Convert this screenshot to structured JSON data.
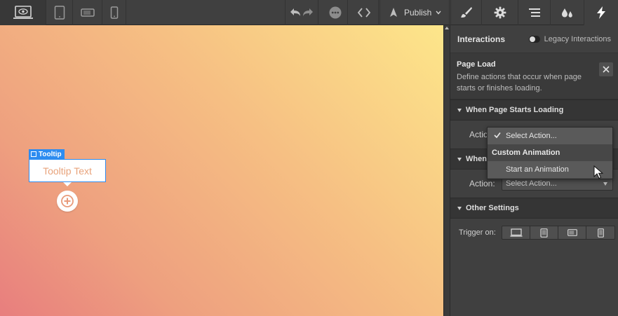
{
  "toolbar": {
    "publish_label": "Publish",
    "devices": [
      "desktop",
      "tablet",
      "mobile-landscape",
      "mobile-portrait"
    ]
  },
  "canvas": {
    "element_label": "Tooltip",
    "tooltip_text": "Tooltip Text"
  },
  "panel": {
    "header_title": "Interactions",
    "legacy_label": "Legacy Interactions",
    "page_load_title": "Page Load",
    "page_load_desc": "Define actions that occur when page starts or finishes loading.",
    "section_starts": "When Page Starts Loading",
    "section_finishes": "When",
    "action_label": "Action:",
    "action_label_top": "Actio",
    "select_placeholder": "Select Action...",
    "section_other": "Other Settings",
    "trigger_label": "Trigger on:"
  },
  "dropdown": {
    "items": [
      "Select Action...",
      "Custom Animation",
      "Start an Animation"
    ]
  },
  "colors": {
    "accent": "#2d8cf0",
    "tooltip_text": "#e8a37b"
  }
}
